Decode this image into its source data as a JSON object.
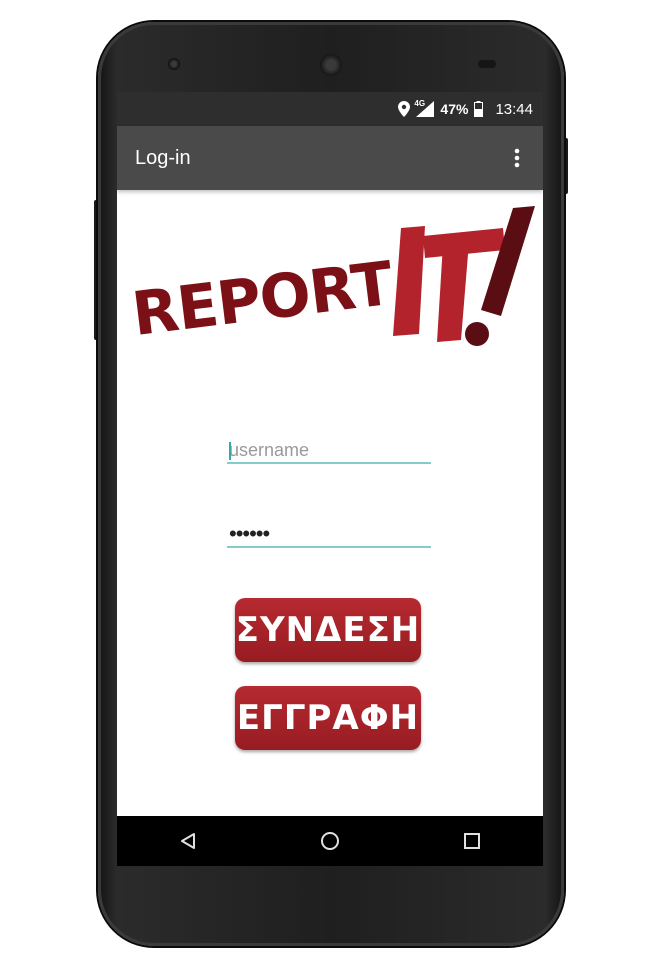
{
  "status_bar": {
    "network": "4G",
    "battery": "47%",
    "time": "13:44",
    "icons": [
      "location-icon",
      "signal-icon",
      "battery-icon"
    ]
  },
  "app_bar": {
    "title": "Log-in",
    "menu_icon": "overflow-menu-icon"
  },
  "logo": {
    "text_primary": "REPORT",
    "text_accent": "IT!",
    "colors": {
      "dark_red": "#7b1016",
      "red": "#b3232b",
      "maroon": "#5a0d12"
    }
  },
  "form": {
    "username_placeholder": "username",
    "username_value": "",
    "password_value": "••••••"
  },
  "buttons": {
    "login_label": "ΣΥΝΔΕΣΗ",
    "register_label": "ΕΓΓΡΑΦΗ"
  },
  "nav_bar": [
    "back-icon",
    "home-icon",
    "recents-icon"
  ],
  "colors": {
    "status_bar": "#2e2e2e",
    "app_bar": "#4a4a4a",
    "input_underline": "#84ccc9",
    "button": "#a8242a",
    "nav_bar": "#000000"
  }
}
